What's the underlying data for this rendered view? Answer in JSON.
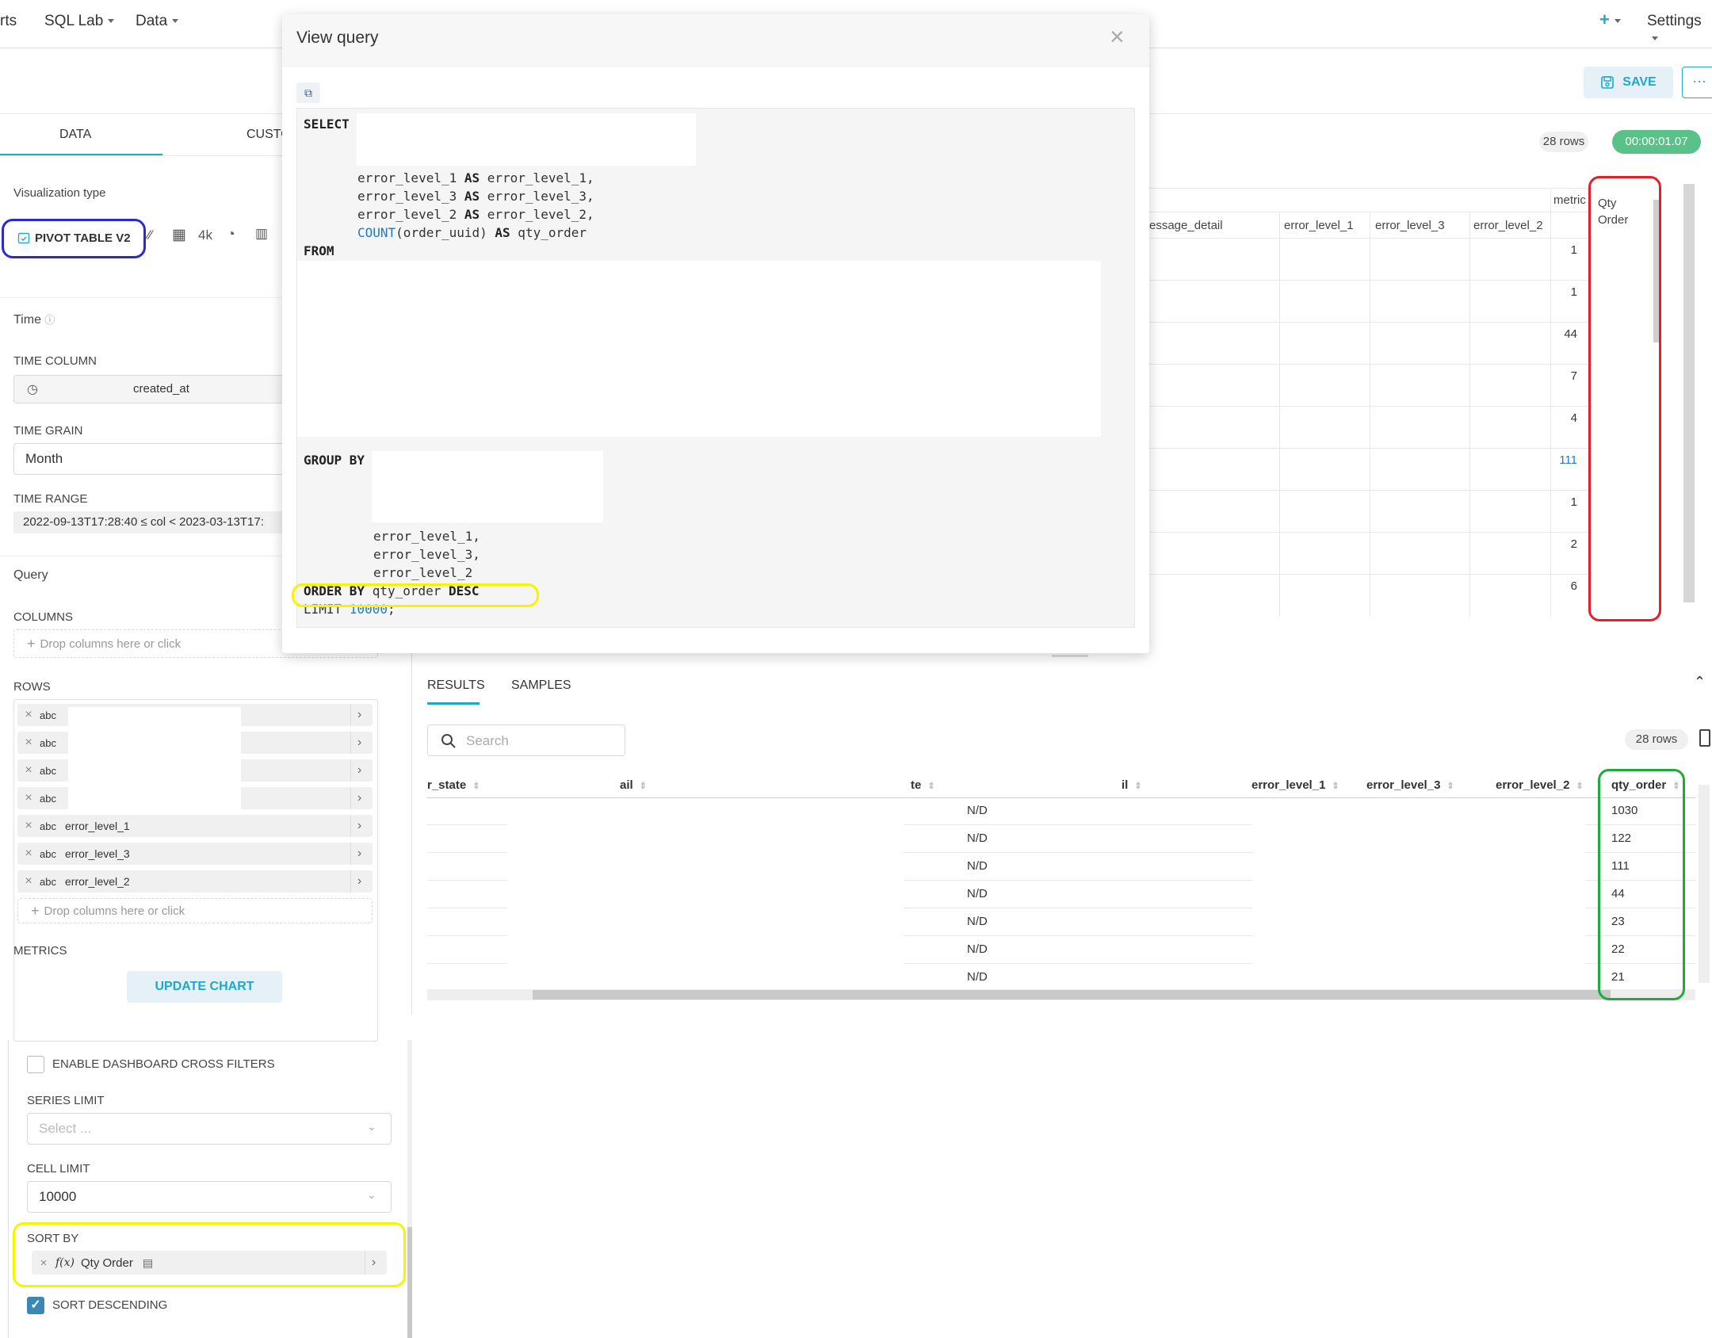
{
  "nav": {
    "items": [
      "rts",
      "SQL Lab",
      "Data"
    ],
    "plus": "+",
    "settings": "Settings"
  },
  "header": {
    "save_label": "SAVE",
    "more_label": "···"
  },
  "left": {
    "tabs": [
      "DATA",
      "CUSTO"
    ],
    "viz_type_label": "Visualization type",
    "viz_type_value": "PIVOT TABLE V2",
    "viz_extra": "4k",
    "time_label": "Time",
    "time_column_label": "TIME COLUMN",
    "time_column_value": "created_at",
    "time_grain_label": "TIME GRAIN",
    "time_grain_value": "Month",
    "time_range_label": "TIME RANGE",
    "time_range_value": "2022-09-13T17:28:40 ≤ col < 2023-03-13T17:",
    "query_label": "Query",
    "columns_label": "COLUMNS",
    "drop_placeholder": "Drop columns here or click",
    "rows_label": "ROWS",
    "rows": [
      {
        "type": "abc",
        "name": ""
      },
      {
        "type": "abc",
        "name": ""
      },
      {
        "type": "abc",
        "name": ""
      },
      {
        "type": "abc",
        "name": ""
      },
      {
        "type": "abc",
        "name": "error_level_1"
      },
      {
        "type": "abc",
        "name": "error_level_3"
      },
      {
        "type": "abc",
        "name": "error_level_2"
      }
    ],
    "metrics_label": "METRICS",
    "update_chart": "UPDATE CHART"
  },
  "chart": {
    "rows_badge": "28 rows",
    "timer_badge": "00:00:01.07",
    "metric_header": "metric",
    "columns": [
      "essage_detail",
      "error_level_1",
      "error_level_3",
      "error_level_2"
    ],
    "qty_header": "Qty Order",
    "qty_values": [
      "1",
      "1",
      "44",
      "7",
      "4",
      "111",
      "1",
      "2",
      "6"
    ]
  },
  "results": {
    "tabs": [
      "RESULTS",
      "SAMPLES"
    ],
    "search_placeholder": "Search",
    "rows_badge": "28 rows",
    "columns": [
      "r_state",
      "ail",
      "te",
      "il",
      "error_level_1",
      "error_level_3",
      "error_level_2",
      "qty_order"
    ],
    "nd_values": [
      "N/D",
      "N/D",
      "N/D",
      "N/D",
      "N/D",
      "N/D",
      "N/D"
    ],
    "qty_values": [
      "1030",
      "122",
      "111",
      "44",
      "23",
      "22",
      "21"
    ]
  },
  "modal": {
    "title": "View query",
    "close": "×",
    "sql": {
      "select": "SELECT",
      "sel1": "error_level_1 ",
      "sel1b": " error_level_1,",
      "sel2": "error_level_3 ",
      "sel2b": " error_level_3,",
      "sel3": "error_level_2 ",
      "sel3b": " error_level_2,",
      "count_fn": "COUNT",
      "count_arg": "(order_uuid) ",
      "count_alias": " qty_order",
      "as": "AS",
      "from": "FROM",
      "group_by": "GROUP BY",
      "gb1": "error_level_1,",
      "gb2": "error_level_3,",
      "gb3": "error_level_2",
      "order_by": "ORDER BY",
      "order_col": " qty_order ",
      "desc": "DESC",
      "limit": "LIMIT ",
      "limit_val": "10000",
      "semicolon": ";"
    }
  },
  "bottom": {
    "cross_filters": "ENABLE DASHBOARD CROSS FILTERS",
    "series_limit_label": "SERIES LIMIT",
    "series_limit_placeholder": "Select ...",
    "cell_limit_label": "CELL LIMIT",
    "cell_limit_value": "10000",
    "sort_by_label": "SORT BY",
    "sort_by_fx": "f(x)",
    "sort_by_value": "Qty Order",
    "sort_desc_label": "SORT DESCENDING",
    "sort_desc_checked": true
  },
  "colors": {
    "accent": "#20a7c9",
    "timer_green": "#5ac189",
    "annot_red": "#e0202a",
    "annot_green": "#1faa3c",
    "annot_blue": "#2a2ad0",
    "annot_yellow": "#f5f500"
  }
}
